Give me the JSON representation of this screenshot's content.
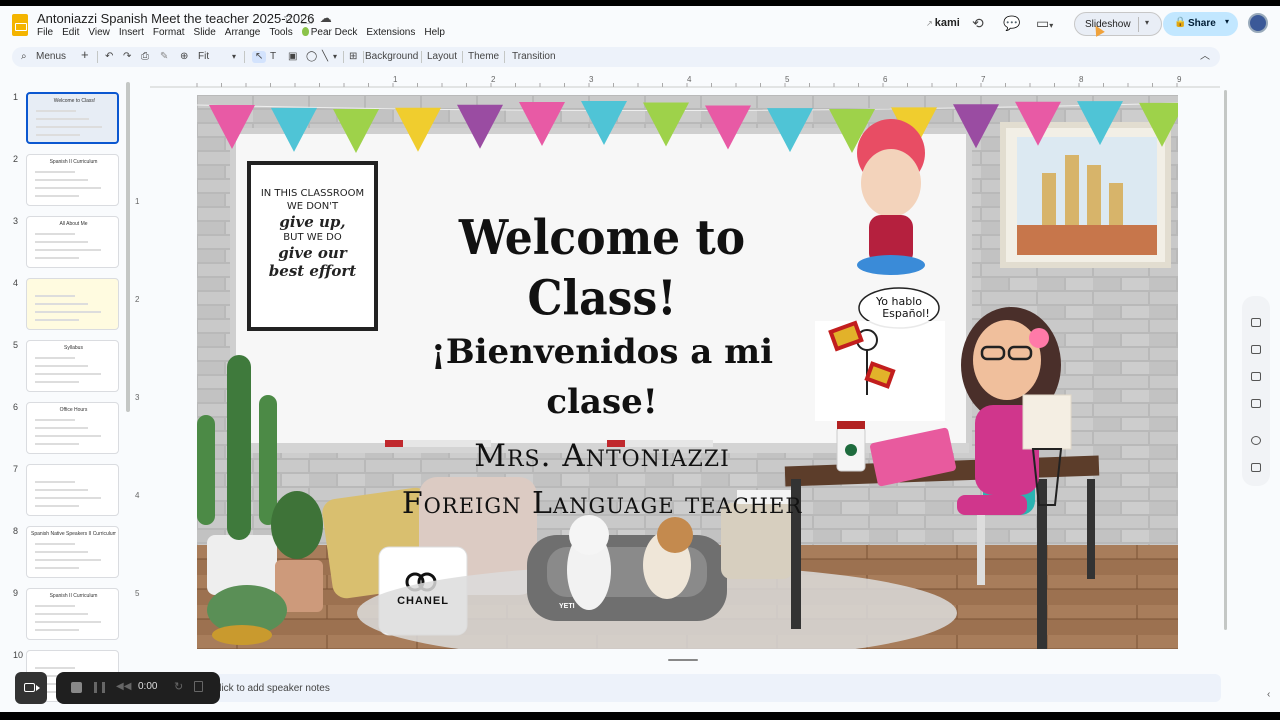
{
  "app": {
    "title": "Antoniazzi Spanish Meet the teacher 2025-2026",
    "star_icon": "star-icon",
    "move_icon": "folder-move-icon",
    "cloud_icon": "cloud-status-icon"
  },
  "menu": [
    "File",
    "Edit",
    "View",
    "Insert",
    "Format",
    "Slide",
    "Arrange",
    "Tools",
    "Pear Deck",
    "Extensions",
    "Help"
  ],
  "header": {
    "kami_label": "kami",
    "slideshow_label": "Slideshow",
    "share_label": "Share"
  },
  "toolbar": {
    "search_label": "Menus",
    "zoom_label": "Fit",
    "background_label": "Background",
    "layout_label": "Layout",
    "theme_label": "Theme",
    "transition_label": "Transition"
  },
  "ruler_numbers": [
    "1",
    "2",
    "3",
    "4",
    "5",
    "6",
    "7",
    "8",
    "9"
  ],
  "ruler_v_numbers": [
    "1",
    "2",
    "3",
    "4",
    "5"
  ],
  "slides": [
    {
      "num": "1",
      "title": "Welcome to Class!"
    },
    {
      "num": "2",
      "title": "Spanish II Curriculum"
    },
    {
      "num": "3",
      "title": "All About Me"
    },
    {
      "num": "4",
      "title": ""
    },
    {
      "num": "5",
      "title": "Syllabus"
    },
    {
      "num": "6",
      "title": "Office Hours"
    },
    {
      "num": "7",
      "title": ""
    },
    {
      "num": "8",
      "title": "Spanish Native Speakers II Curriculum"
    },
    {
      "num": "9",
      "title": "Spanish II Curriculum"
    },
    {
      "num": "10",
      "title": ""
    }
  ],
  "slide": {
    "poster_text": [
      "IN THIS CLASSROOM",
      "WE DON'T",
      "give up,",
      "BUT WE DO",
      "give our",
      "best effort"
    ],
    "heading": "Welcome to Class!",
    "subheading": "¡Bienvenidos a mi clase!",
    "teacher_name": "Mrs. Antoniazzi",
    "teacher_role": "Foreign Language teacher",
    "speech_bubble": [
      "Yo hablo",
      "Español!"
    ],
    "pillow_brand": "CHANEL",
    "bed_brand": "YETI"
  },
  "notes_label": "Click to add speaker notes",
  "recorder": {
    "time": "0:00"
  },
  "colors": {
    "accent": "#0b57d0",
    "share_bg": "#c2e7ff",
    "brick": "#bdbdbd",
    "floor": "#a0764f"
  }
}
